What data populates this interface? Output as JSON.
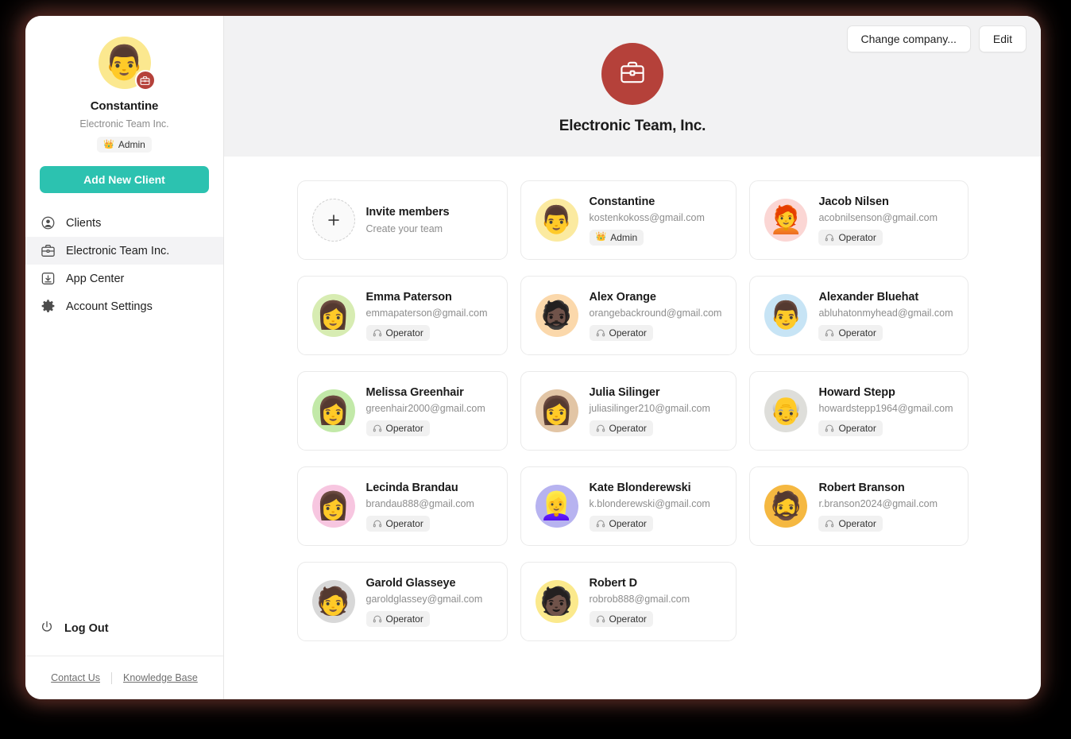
{
  "sidebar": {
    "profile": {
      "name": "Constantine",
      "company": "Electronic Team Inc.",
      "role_badge": "Admin",
      "role_emoji": "👑",
      "avatar_emoji": "👨",
      "avatar_bg": "#fbe88f",
      "badge_icon": "briefcase-icon",
      "badge_color": "#b5413a"
    },
    "add_client_label": "Add New Client",
    "add_client_color": "#2cc2b0",
    "items": [
      {
        "label": "Clients",
        "icon": "user-circle-icon",
        "active": false
      },
      {
        "label": "Electronic Team Inc.",
        "icon": "briefcase-icon",
        "active": true
      },
      {
        "label": "App Center",
        "icon": "download-box-icon",
        "active": false
      },
      {
        "label": "Account Settings",
        "icon": "gear-icon",
        "active": false
      }
    ],
    "logout_label": "Log Out",
    "footer": {
      "contact_label": "Contact Us",
      "knowledge_label": "Knowledge Base"
    }
  },
  "header": {
    "change_company_label": "Change company...",
    "edit_label": "Edit",
    "company_title": "Electronic Team, Inc.",
    "logo_icon": "briefcase-icon",
    "logo_color": "#b5413a",
    "background": "#f2f2f3"
  },
  "invite_card": {
    "title": "Invite members",
    "subtitle": "Create your team",
    "icon": "plus-icon"
  },
  "members": [
    {
      "name": "Constantine",
      "email": "kostenkokoss@gmail.com",
      "role": "Admin",
      "role_emoji": "👑",
      "avatar_emoji": "👨",
      "avatar_bg": "#fbeaa0"
    },
    {
      "name": "Jacob Nilsen",
      "email": "acobnilsenson@gmail.com",
      "role": "Operator",
      "role_emoji": "",
      "avatar_emoji": "🧑‍🦰",
      "avatar_bg": "#fbd6d4"
    },
    {
      "name": "Emma Paterson",
      "email": "emmapaterson@gmail.com",
      "role": "Operator",
      "role_emoji": "",
      "avatar_emoji": "👩",
      "avatar_bg": "#d7ecb2"
    },
    {
      "name": "Alex Orange",
      "email": "orangebackround@gmail.com",
      "role": "Operator",
      "role_emoji": "",
      "avatar_emoji": "🧔🏿",
      "avatar_bg": "#fbd8ab"
    },
    {
      "name": "Alexander Bluehat",
      "email": "abluhatonmyhead@gmail.com",
      "role": "Operator",
      "role_emoji": "",
      "avatar_emoji": "👨",
      "avatar_bg": "#c7e4f5"
    },
    {
      "name": "Melissa Greenhair",
      "email": "greenhair2000@gmail.com",
      "role": "Operator",
      "role_emoji": "",
      "avatar_emoji": "👩",
      "avatar_bg": "#c2e9a8"
    },
    {
      "name": "Julia Silinger",
      "email": "juliasilinger210@gmail.com",
      "role": "Operator",
      "role_emoji": "",
      "avatar_emoji": "👩",
      "avatar_bg": "#e2c5a5"
    },
    {
      "name": "Howard Stepp",
      "email": "howardstepp1964@gmail.com",
      "role": "Operator",
      "role_emoji": "",
      "avatar_emoji": "👴",
      "avatar_bg": "#dededa"
    },
    {
      "name": "Lecinda Brandau",
      "email": "brandau888@gmail.com",
      "role": "Operator",
      "role_emoji": "",
      "avatar_emoji": "👩",
      "avatar_bg": "#f7c6e0"
    },
    {
      "name": "Kate Blonderewski",
      "email": "k.blonderewski@gmail.com",
      "role": "Operator",
      "role_emoji": "",
      "avatar_emoji": "👱‍♀️",
      "avatar_bg": "#b7b3f0"
    },
    {
      "name": "Robert Branson",
      "email": "r.branson2024@gmail.com",
      "role": "Operator",
      "role_emoji": "",
      "avatar_emoji": "🧔",
      "avatar_bg": "#f5b841"
    },
    {
      "name": "Garold Glasseye",
      "email": "garoldglassey@gmail.com",
      "role": "Operator",
      "role_emoji": "",
      "avatar_emoji": "🧑",
      "avatar_bg": "#d8d8d8"
    },
    {
      "name": "Robert D",
      "email": "robrob888@gmail.com",
      "role": "Operator",
      "role_emoji": "",
      "avatar_emoji": "🧑🏿",
      "avatar_bg": "#fbe98c"
    }
  ]
}
